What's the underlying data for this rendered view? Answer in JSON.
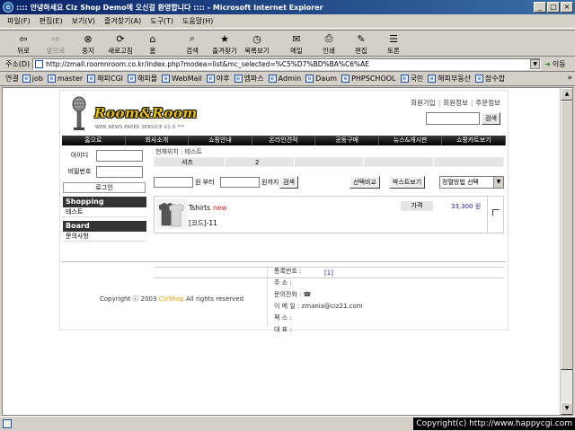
{
  "window": {
    "title": ":::: 안녕하세요 Ciz Shop Demo에 오신걸 환영합니다 :::: - Microsoft Internet Explorer",
    "min_glyph": "_",
    "max_glyph": "□",
    "close_glyph": "×"
  },
  "menu": [
    "파일(F)",
    "편집(E)",
    "보기(V)",
    "즐겨찾기(A)",
    "도구(T)",
    "도움말(H)"
  ],
  "toolbar": {
    "back": "뒤로",
    "forward": "앞으로",
    "stop": "중지",
    "refresh": "새로고침",
    "home": "홈",
    "search": "검색",
    "favorites": "즐겨찾기",
    "history": "목록보기",
    "mail": "메일",
    "print": "인쇄",
    "edit": "편집",
    "discuss": "토론"
  },
  "address": {
    "label": "주소(D)",
    "url": "http://zmall.roomnroom.co.kr/index.php?modea=list&mc_selected=%C5%D7%BD%BA%C6%AE",
    "go": "이동"
  },
  "links": {
    "label": "연결",
    "items": [
      "job",
      "master",
      "해피CGI",
      "해피몰",
      "WebMail",
      "야후",
      "엠파스",
      "Admin",
      "Daum",
      "PHPSCHOOL",
      "국민",
      "해피부동산",
      "잡수합"
    ]
  },
  "site": {
    "logo": "Room&Room",
    "logo_sub": "WEB NEWS PAPER SERVICE V1.0 ***",
    "top_links": [
      "회원가입",
      "회원정보",
      "주문정보"
    ],
    "search_button": "검색",
    "nav": [
      "홈으로",
      "회사소개",
      "쇼핑안내",
      "온라인견적",
      "공동구매",
      "뉴스&게시판",
      "쇼핑카트보기"
    ],
    "login": {
      "id_label": "아이디",
      "pw_label": "비밀번호",
      "button": "로그인"
    },
    "categories": [
      {
        "head": "Shopping",
        "items": [
          "테스트"
        ]
      },
      {
        "head": "Board",
        "items": [
          "문의사항"
        ]
      }
    ],
    "location": "현재위치 : 테스트",
    "subcats": [
      "셔츠",
      "2"
    ],
    "filter": {
      "from_label": "원 부터",
      "to_label": "원까지",
      "search": "검색",
      "compare": "선택비교",
      "basket": "박스트보기",
      "sort": "정렬방법 선택"
    },
    "products": [
      {
        "name": "Tshirts",
        "badge": "new",
        "code": "[코드]-11",
        "price_label": "가격",
        "price": "33,300 원"
      }
    ],
    "pager": "[1]",
    "footer": {
      "copyright_pre": "Copyright ⓒ 2003 ",
      "brand": "CizShop",
      "copyright_post": " All rights reserved",
      "info": [
        "통록번호 :",
        "주      소 :",
        "문의전화 : ☎",
        "이 메 일 : zmania@ciz21.com",
        "팩      스 :",
        "대      표 :"
      ]
    }
  },
  "status": {
    "copyright": "Copyright(c) http://www.happycgi.com"
  }
}
